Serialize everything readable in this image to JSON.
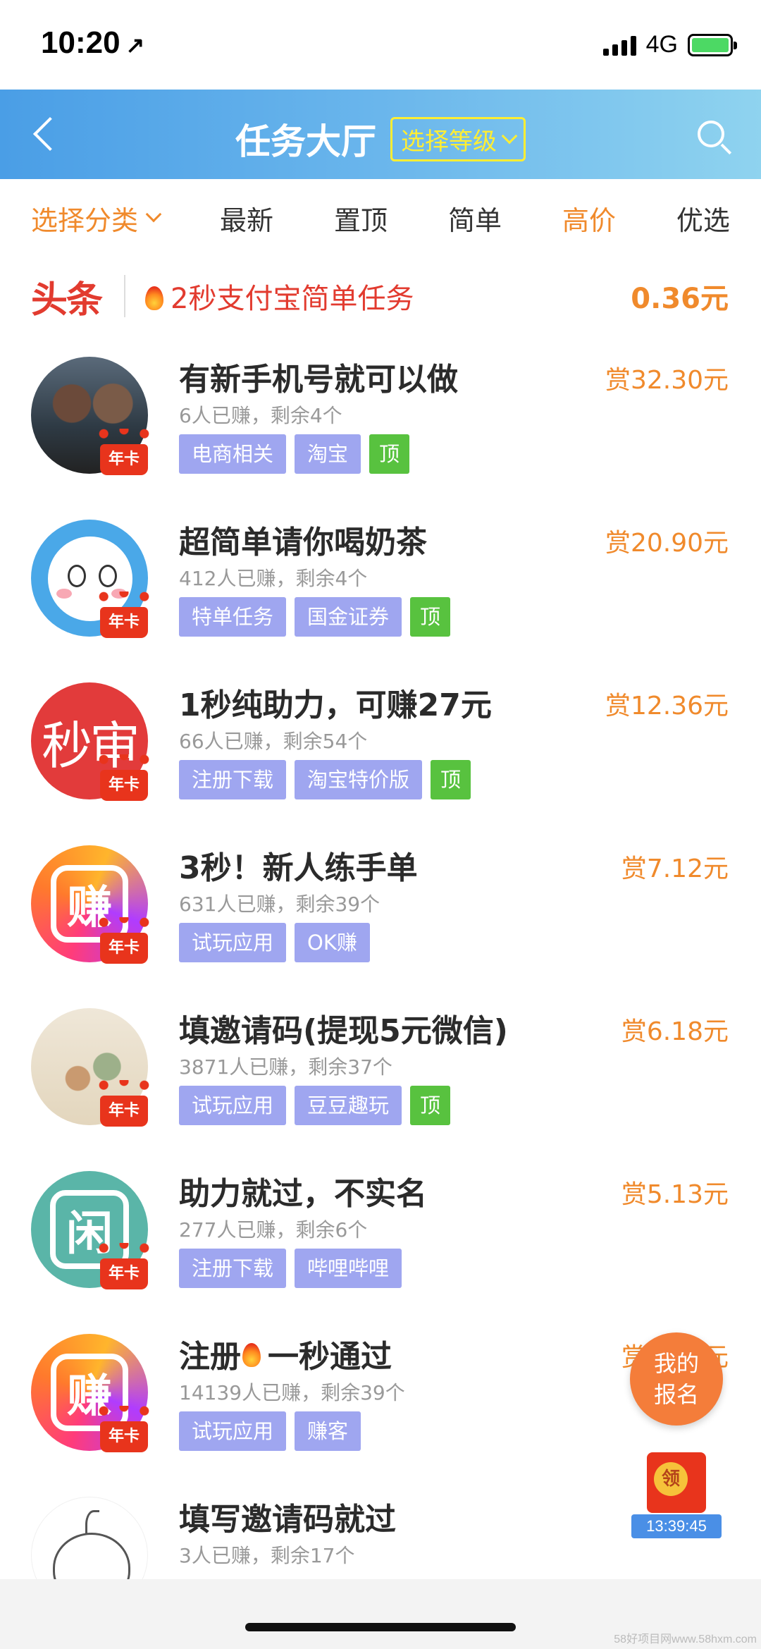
{
  "status_bar": {
    "time": "10:20",
    "location_glyph": "↗",
    "network": "4G"
  },
  "header": {
    "title": "任务大厅",
    "level_button": "选择等级"
  },
  "filters": {
    "category": "选择分类",
    "items": [
      "最新",
      "置顶",
      "简单",
      "高价",
      "优选"
    ],
    "active_item_index": 3
  },
  "headline": {
    "tag": "头条",
    "text": "2秒支付宝简单任务",
    "price": "0.36元"
  },
  "tasks": [
    {
      "title": "有新手机号就可以做",
      "meta": "6人已赚，剩余4个",
      "reward": "赏32.30元",
      "tags": [
        "电商相关",
        "淘宝"
      ],
      "top_tag": "顶",
      "badge": "年卡"
    },
    {
      "title": "超简单请你喝奶茶",
      "meta": "412人已赚，剩余4个",
      "reward": "赏20.90元",
      "tags": [
        "特单任务",
        "国金证券"
      ],
      "top_tag": "顶",
      "badge": "年卡"
    },
    {
      "title": "1秒纯助力，可赚27元",
      "meta": "66人已赚，剩余54个",
      "reward": "赏12.36元",
      "tags": [
        "注册下载",
        "淘宝特价版"
      ],
      "top_tag": "顶",
      "badge": "年卡",
      "avatar_text": "秒审"
    },
    {
      "title": "3秒！新人练手单",
      "meta": "631人已赚，剩余39个",
      "reward": "赏7.12元",
      "tags": [
        "试玩应用",
        "OK赚"
      ],
      "top_tag": "",
      "badge": "年卡",
      "avatar_text": "赚"
    },
    {
      "title": "填邀请码(提现5元微信)",
      "meta": "3871人已赚，剩余37个",
      "reward": "赏6.18元",
      "tags": [
        "试玩应用",
        "豆豆趣玩"
      ],
      "top_tag": "顶",
      "badge": "年卡"
    },
    {
      "title": "助力就过，不实名",
      "meta": "277人已赚，剩余6个",
      "reward": "赏5.13元",
      "tags": [
        "注册下载",
        "哔哩哔哩"
      ],
      "top_tag": "",
      "badge": "年卡",
      "avatar_text": "闲"
    },
    {
      "title_pre": "注册",
      "title_post": "一秒通过",
      "meta": "14139人已赚，剩余39个",
      "reward": "赏8.55元",
      "tags": [
        "试玩应用",
        "赚客"
      ],
      "top_tag": "",
      "badge": "年卡",
      "avatar_text": "赚"
    },
    {
      "title": "填写邀请码就过",
      "meta": "3人已赚，剩余17个",
      "reward": "",
      "tags": [],
      "top_tag": "",
      "badge": ""
    }
  ],
  "floating": {
    "signup_line1": "我的",
    "signup_line2": "报名",
    "redpack_coin": "领",
    "redpack_timer": "13:39:45"
  },
  "watermark": "58好项目网www.58hxm.com",
  "colors": {
    "header_gradient_start": "#4a9ee6",
    "header_gradient_end": "#8fd3ef",
    "accent_orange": "#f08a2c",
    "headline_red": "#e23b2f",
    "tag_purple": "#9fa6f0",
    "tag_green": "#58c23f"
  }
}
